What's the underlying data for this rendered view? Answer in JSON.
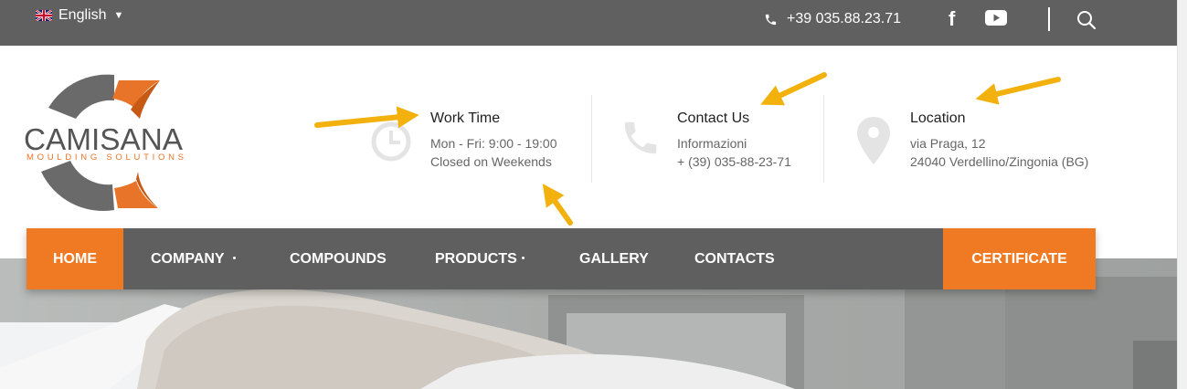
{
  "topbar": {
    "language": "English",
    "phone": "+39 035.88.23.71",
    "facebook_glyph": "f",
    "icons": [
      "uk-flag-icon",
      "chevron-down-icon",
      "phone-icon",
      "facebook-icon",
      "youtube-icon",
      "search-icon"
    ]
  },
  "logo": {
    "brand": "CAMISANA",
    "tagline": "MOULDING SOLUTIONS"
  },
  "info": {
    "work_time": {
      "title": "Work Time",
      "line1": "Mon - Fri: 9:00 - 19:00",
      "line2": "Closed on Weekends",
      "icon": "clock-icon"
    },
    "contact": {
      "title": "Contact Us",
      "line1": "Informazioni",
      "line2": "+ (39) 035-88-23-71",
      "icon": "phone-icon"
    },
    "location": {
      "title": "Location",
      "line1": "via Praga, 12",
      "line2": "24040 Verdellino/Zingonia (BG)",
      "icon": "map-pin-icon"
    }
  },
  "nav": {
    "items": [
      {
        "label": "HOME",
        "active": true
      },
      {
        "label": "COMPANY",
        "has_submenu": true
      },
      {
        "label": "COMPOUNDS"
      },
      {
        "label": "PRODUCTS",
        "has_submenu": true
      },
      {
        "label": "GALLERY"
      },
      {
        "label": "CONTACTS"
      }
    ],
    "cta": "CERTIFICATE"
  },
  "colors": {
    "topbar": "#606060",
    "accent": "#f07a24",
    "nav": "#5f5f5f",
    "annotation_arrow": "#f2b10c"
  }
}
